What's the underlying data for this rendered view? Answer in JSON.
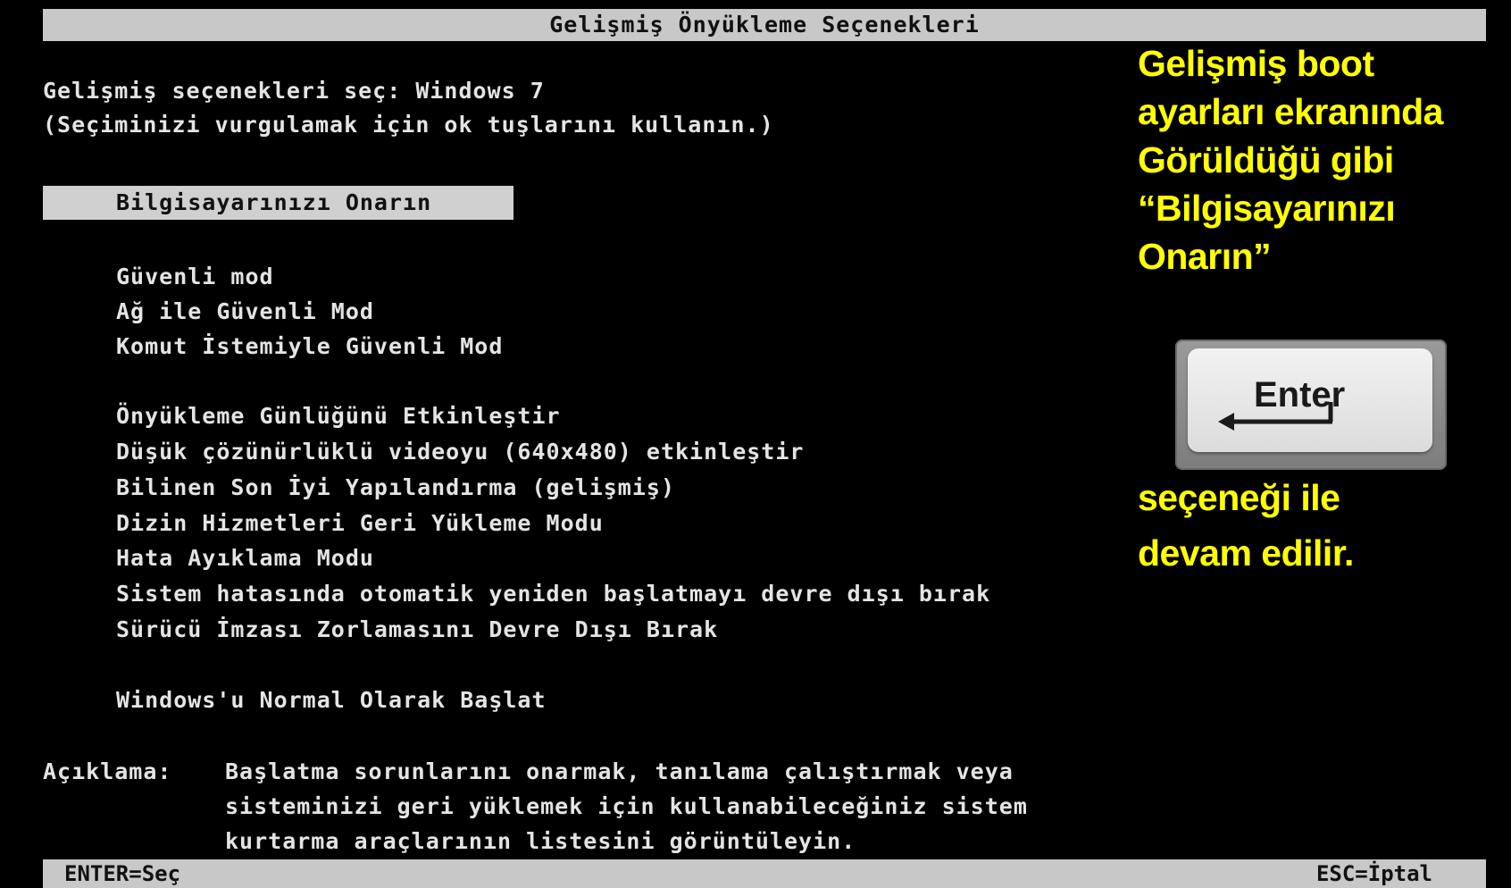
{
  "boot_screen": {
    "title": "Gelişmiş Önyükleme Seçenekleri",
    "prompt_line1": "Gelişmiş seçenekleri seç: Windows 7",
    "prompt_line2": "(Seçiminizi vurgulamak için ok tuşlarını kullanın.)",
    "selected_item": "Bilgisayarınızı Onarın",
    "menu_groups": [
      [
        "Güvenli mod",
        "Ağ ile Güvenli Mod",
        "Komut İstemiyle Güvenli Mod"
      ],
      [
        "Önyükleme Günlüğünü Etkinleştir",
        "Düşük çözünürlüklü videoyu (640x480) etkinleştir",
        "Bilinen Son İyi Yapılandırma (gelişmiş)",
        "Dizin Hizmetleri Geri Yükleme Modu",
        "Hata Ayıklama Modu",
        "Sistem hatasında otomatik yeniden başlatmayı devre dışı bırak",
        "Sürücü İmzası Zorlamasını Devre Dışı Bırak"
      ],
      [
        "Windows'u Normal Olarak Başlat"
      ]
    ],
    "description_label": "Açıklama:",
    "description_lines": [
      "Başlatma sorunlarını onarmak, tanılama çalıştırmak veya",
      "sisteminizi geri yüklemek için kullanabileceğiniz sistem",
      "kurtarma araçlarının listesini görüntüleyin."
    ],
    "footer_left": "ENTER=Seç",
    "footer_right": "ESC=İptal"
  },
  "annotation": {
    "top_lines": [
      "Gelişmiş boot",
      "ayarları ekranında",
      "Görüldüğü gibi",
      "“Bilgisayarınızı",
      "Onarın”"
    ],
    "key_label": "Enter",
    "bottom_lines": [
      "seçeneği ile",
      "devam edilir."
    ],
    "text_color": "#ffff00",
    "key_icon": "enter-key-icon"
  }
}
